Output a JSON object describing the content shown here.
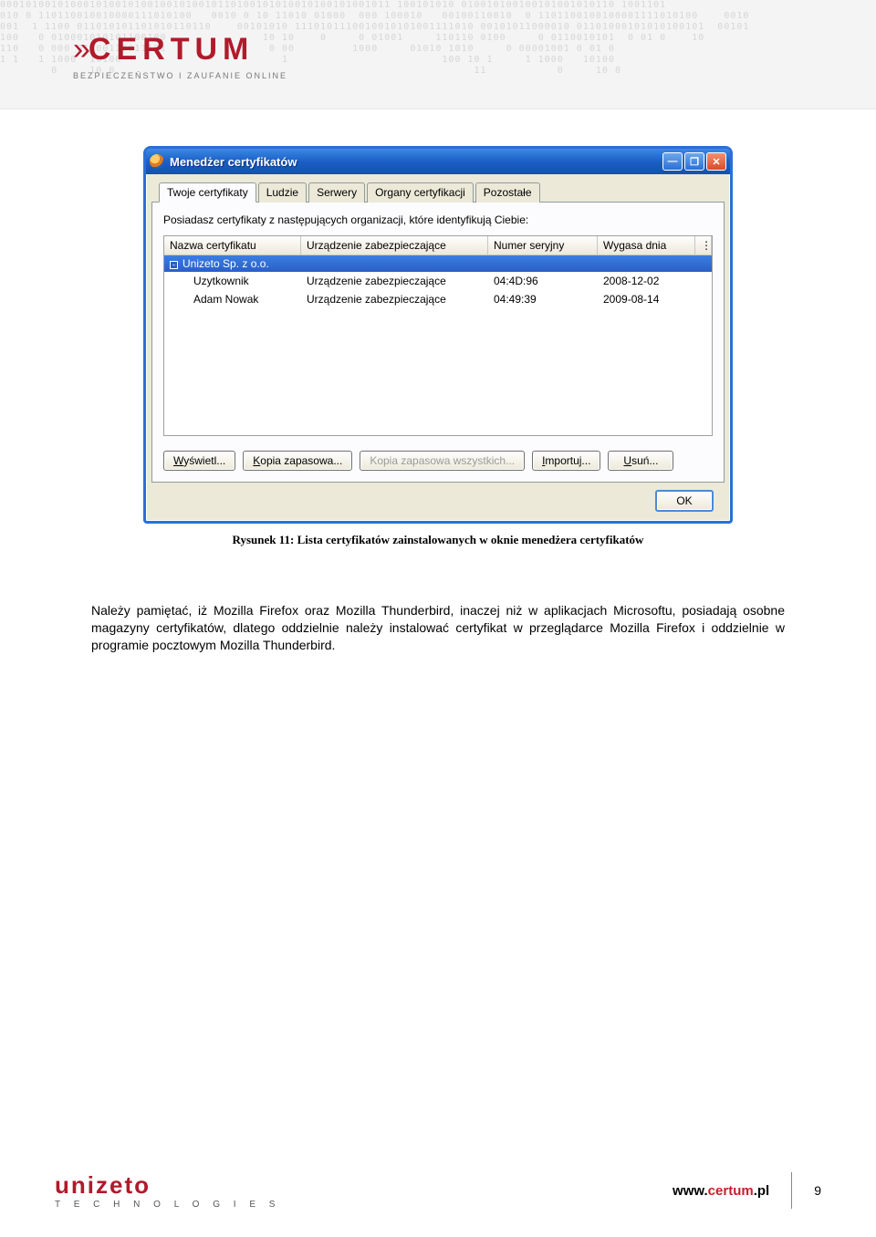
{
  "header": {
    "brand": "CERTUM",
    "tagline": "BEZPIECZEŃSTWO I ZAUFANIE ONLINE"
  },
  "window": {
    "title": "Menedżer certyfikatów",
    "tabs": [
      "Twoje certyfikaty",
      "Ludzie",
      "Serwery",
      "Organy certyfikacji",
      "Pozostałe"
    ],
    "activeTab": 0,
    "panelText": "Posiadasz certyfikaty z następujących organizacji, które identyfikują Ciebie:",
    "columns": {
      "name": "Nazwa certyfikatu",
      "device": "Urządzenie zabezpieczające",
      "serial": "Numer seryjny",
      "expires": "Wygasa dnia"
    },
    "group": "Unizeto Sp. z o.o.",
    "rows": [
      {
        "name": "Uzytkownik",
        "device": "Urządzenie zabezpieczające",
        "serial": "04:4D:96",
        "expires": "2008-12-02"
      },
      {
        "name": "Adam Nowak",
        "device": "Urządzenie zabezpieczające",
        "serial": "04:49:39",
        "expires": "2009-08-14"
      }
    ],
    "buttons": {
      "view": "Wyświetl...",
      "backup": "Kopia zapasowa...",
      "backupAll": "Kopia zapasowa wszystkich...",
      "import": "Importuj...",
      "delete": "Usuń...",
      "ok": "OK"
    }
  },
  "caption": "Rysunek 11: Lista certyfikatów zainstalowanych w oknie menedżera certyfikatów",
  "paragraph": "Należy pamiętać, iż Mozilla Firefox oraz Mozilla Thunderbird, inaczej niż w aplikacjach Microsoftu, posiadają osobne magazyny certyfikatów, dlatego oddzielnie należy instalować certyfikat w przeglądarce Mozilla Firefox i oddzielnie w programie pocztowym Mozilla Thunderbird.",
  "footer": {
    "brand": "unizeto",
    "brandTag": "T E C H N O L O G I E S",
    "urlPrefix": "www.",
    "urlMain": "certum",
    "urlSuffix": ".pl",
    "page": "9"
  }
}
